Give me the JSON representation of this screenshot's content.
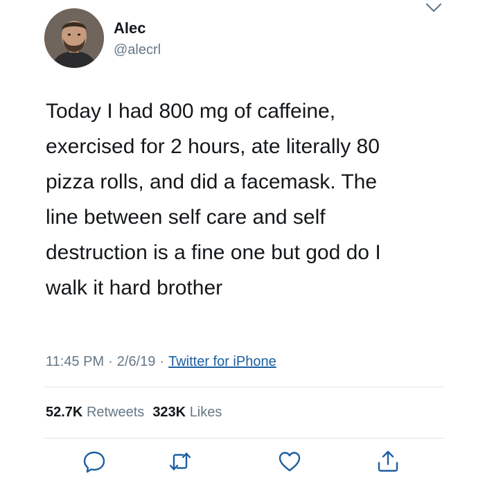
{
  "user": {
    "name": "Alec",
    "handle": "@alecrl"
  },
  "tweet": {
    "text": "Today I had 800 mg of caffeine,\nexercised for 2 hours, ate literally 80\npizza rolls, and did a facemask. The\nline between self care and self\ndestruction is a fine one but god do I\nwalk it hard brother",
    "time": "11:45 PM",
    "date": "2/6/19",
    "separator": "·",
    "source": "Twitter for iPhone"
  },
  "stats": {
    "retweets_count": "52.7K",
    "retweets_label": "Retweets",
    "likes_count": "323K",
    "likes_label": "Likes"
  },
  "icons": {
    "menu": "chevron-down-icon",
    "reply": "reply-icon",
    "retweet": "retweet-icon",
    "like": "heart-icon",
    "share": "share-icon"
  },
  "colors": {
    "text": "#14171a",
    "secondary": "#657786",
    "link": "#1b5ea0",
    "divider": "#dfe3e7",
    "icon": "#1b5ea0"
  }
}
